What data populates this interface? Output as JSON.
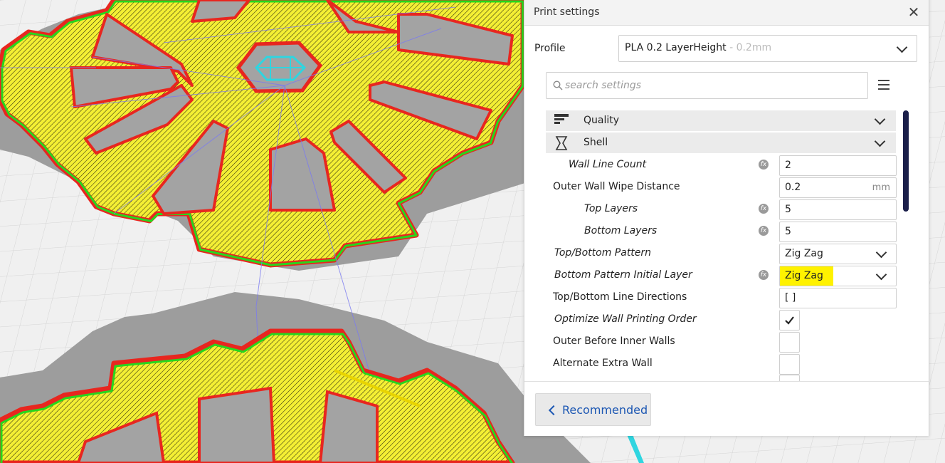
{
  "panel": {
    "title": "Print settings",
    "close_icon": "close-icon",
    "profile_label": "Profile",
    "profile_value": "PLA 0.2 LayerHeight",
    "profile_suffix": " - 0.2mm",
    "search_placeholder": "search settings",
    "menu_icon": "hamburger-icon",
    "sections": [
      {
        "label": "Quality",
        "icon": "quality-icon"
      },
      {
        "label": "Shell",
        "icon": "shell-icon"
      }
    ],
    "settings": [
      {
        "label": "Wall Line Count",
        "value": "2",
        "fx": true
      },
      {
        "label": "Outer Wall Wipe Distance",
        "value": "0.2",
        "unit": "mm"
      },
      {
        "label": "Top Layers",
        "value": "5",
        "fx": true
      },
      {
        "label": "Bottom Layers",
        "value": "5",
        "fx": true
      },
      {
        "label": "Top/Bottom Pattern",
        "value": "Zig Zag",
        "type": "dropdown"
      },
      {
        "label": "Bottom Pattern Initial Layer",
        "value": "Zig Zag",
        "type": "dropdown",
        "fx": true,
        "highlighted": true
      },
      {
        "label": "Top/Bottom Line Directions",
        "value": "[ ]"
      },
      {
        "label": "Optimize Wall Printing Order",
        "checked": true
      },
      {
        "label": "Outer Before Inner Walls",
        "checked": false
      },
      {
        "label": "Alternate Extra Wall",
        "checked": false
      }
    ],
    "recommended_label": "Recommended"
  },
  "colors": {
    "infill": "#f2ee3a",
    "outer_wall": "#e8261f",
    "inner_wall": "#27d71d",
    "support": "#9a9a9a",
    "travel": "#7b7bf0",
    "highlight": "#fff200",
    "accent": "#1c57b3"
  }
}
